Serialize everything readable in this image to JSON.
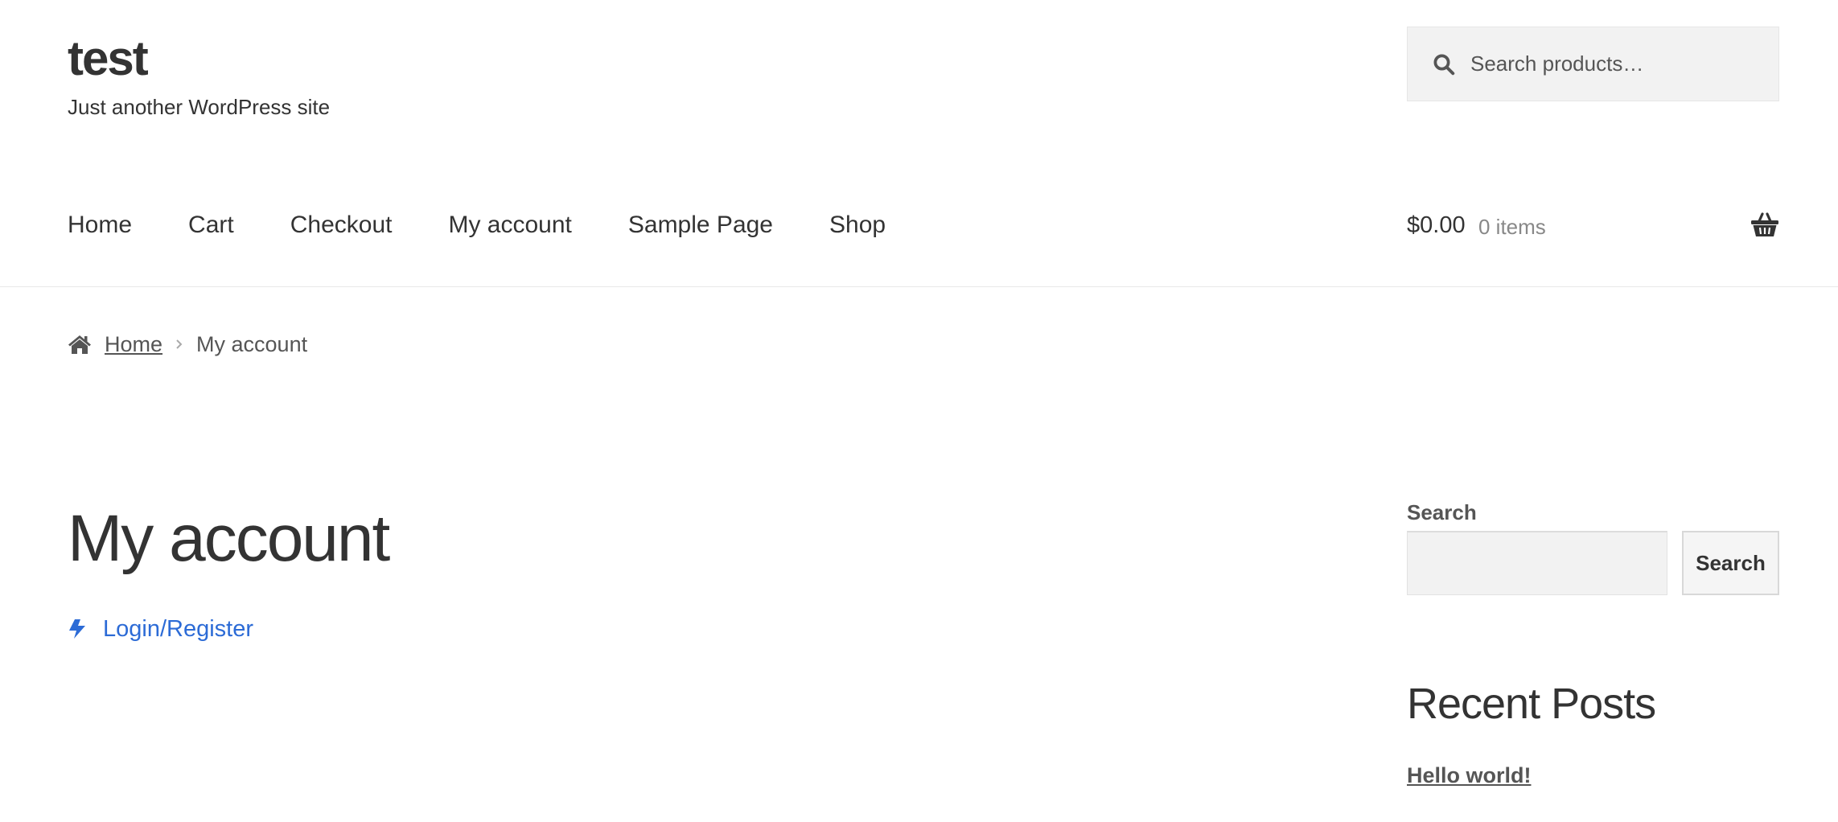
{
  "site": {
    "title": "test",
    "tagline": "Just another WordPress site"
  },
  "header_search": {
    "placeholder": "Search products…",
    "icon": "search-icon"
  },
  "nav": {
    "items": [
      {
        "label": "Home"
      },
      {
        "label": "Cart"
      },
      {
        "label": "Checkout"
      },
      {
        "label": "My account"
      },
      {
        "label": "Sample Page"
      },
      {
        "label": "Shop"
      }
    ]
  },
  "cart": {
    "amount": "$0.00",
    "count": "0 items",
    "icon": "basket-icon"
  },
  "breadcrumb": {
    "home_label": "Home",
    "current": "My account",
    "icon": "home-icon"
  },
  "main": {
    "title": "My account",
    "login_link": "Login/Register",
    "login_icon": "bolt-icon",
    "link_color": "#2c6bd6"
  },
  "sidebar": {
    "search_widget_title": "Search",
    "search_button": "Search",
    "recent_posts_title": "Recent Posts",
    "recent_posts": [
      {
        "label": "Hello world!"
      }
    ]
  }
}
